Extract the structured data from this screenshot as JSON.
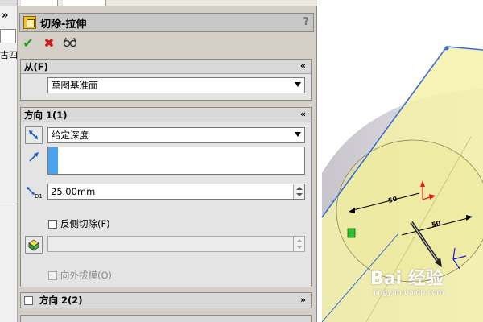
{
  "left_panel": {
    "chevron": "»",
    "partial_text": "古四"
  },
  "feature": {
    "title": "切除-拉伸",
    "help": "?"
  },
  "actions": {
    "ok": "✔",
    "cancel": "✖",
    "preview": "66"
  },
  "from_group": {
    "title": "从(F)",
    "collapse": "«",
    "start_condition": "草图基准面"
  },
  "direction1": {
    "title": "方向 1(1)",
    "collapse": "«",
    "end_condition": "给定深度",
    "depth": "25.00mm",
    "flip_side_label": "反侧切除(F)",
    "draft_label": "向外拔模(O)"
  },
  "direction2": {
    "title": "方向 2(2)",
    "collapse": "»"
  },
  "watermark": {
    "brand": "Bai 经验",
    "url": "jingyan.baidu.com"
  },
  "viewport": {
    "dim_left": "50",
    "dim_right": "50",
    "colors": {
      "face_yellow": "#f3f1a8",
      "body_gray": "#d4d0d4",
      "edge_blue": "#3a6fd8",
      "dim_red": "#e02020"
    }
  }
}
